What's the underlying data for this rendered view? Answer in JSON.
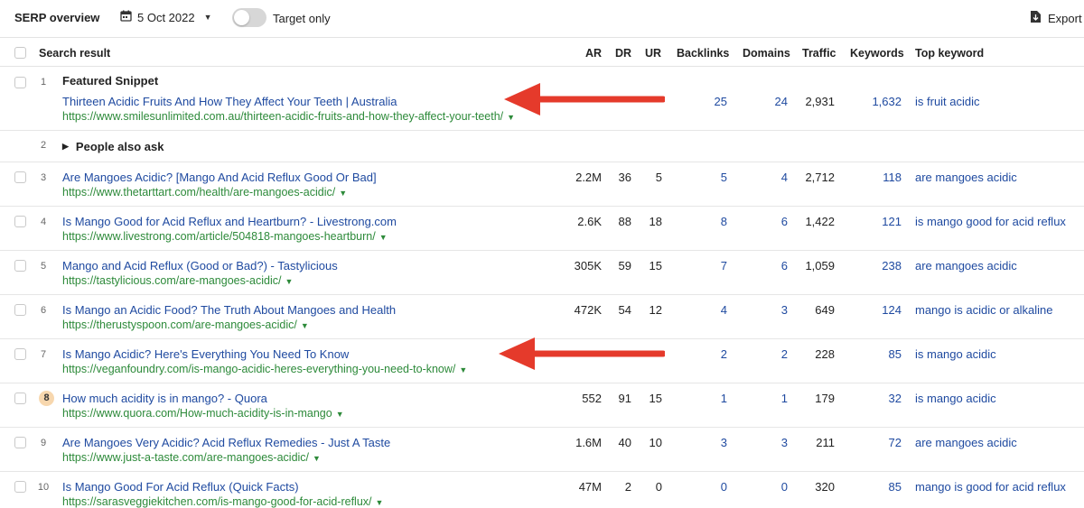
{
  "header": {
    "title": "SERP overview",
    "date": "5 Oct 2022",
    "toggle_label": "Target only",
    "export_label": "Export"
  },
  "columns": {
    "search_result": "Search result",
    "ar": "AR",
    "dr": "DR",
    "ur": "UR",
    "backlinks": "Backlinks",
    "domains": "Domains",
    "traffic": "Traffic",
    "keywords": "Keywords",
    "top_keyword": "Top keyword"
  },
  "featured": {
    "position": "1",
    "label": "Featured Snippet",
    "title": "Thirteen Acidic Fruits And How They Affect Your Teeth | Australia",
    "url": "https://www.smilesunlimited.com.au/thirteen-acidic-fruits-and-how-they-affect-your-teeth/",
    "ar": "",
    "dr": "",
    "ur": "",
    "backlinks": "25",
    "domains": "24",
    "traffic": "2,931",
    "keywords": "1,632",
    "top_keyword": "is fruit acidic"
  },
  "paa": {
    "position": "2",
    "label": "People also ask"
  },
  "rows": [
    {
      "position": "3",
      "title": "Are Mangoes Acidic? [Mango And Acid Reflux Good Or Bad]",
      "url": "https://www.thetarttart.com/health/are-mangoes-acidic/",
      "ar": "2.2M",
      "dr": "36",
      "ur": "5",
      "backlinks": "5",
      "domains": "4",
      "traffic": "2,712",
      "keywords": "118",
      "top_keyword": "are mangoes acidic"
    },
    {
      "position": "4",
      "title": "Is Mango Good for Acid Reflux and Heartburn? - Livestrong.com",
      "url": "https://www.livestrong.com/article/504818-mangoes-heartburn/",
      "ar": "2.6K",
      "dr": "88",
      "ur": "18",
      "backlinks": "8",
      "domains": "6",
      "traffic": "1,422",
      "keywords": "121",
      "top_keyword": "is mango good for acid reflux"
    },
    {
      "position": "5",
      "title": "Mango and Acid Reflux (Good or Bad?) - Tastylicious",
      "url": "https://tastylicious.com/are-mangoes-acidic/",
      "ar": "305K",
      "dr": "59",
      "ur": "15",
      "backlinks": "7",
      "domains": "6",
      "traffic": "1,059",
      "keywords": "238",
      "top_keyword": "are mangoes acidic"
    },
    {
      "position": "6",
      "title": "Is Mango an Acidic Food? The Truth About Mangoes and Health",
      "url": "https://therustyspoon.com/are-mangoes-acidic/",
      "ar": "472K",
      "dr": "54",
      "ur": "12",
      "backlinks": "4",
      "domains": "3",
      "traffic": "649",
      "keywords": "124",
      "top_keyword": "mango is acidic or alkaline"
    },
    {
      "position": "7",
      "title": "Is Mango Acidic? Here's Everything You Need To Know",
      "url": "https://veganfoundry.com/is-mango-acidic-heres-everything-you-need-to-know/",
      "ar": "",
      "dr": "",
      "ur": "",
      "backlinks": "2",
      "domains": "2",
      "traffic": "228",
      "keywords": "85",
      "top_keyword": "is mango acidic"
    },
    {
      "position": "8",
      "title": "How much acidity is in mango? - Quora",
      "url": "https://www.quora.com/How-much-acidity-is-in-mango",
      "ar": "552",
      "dr": "91",
      "ur": "15",
      "backlinks": "1",
      "domains": "1",
      "traffic": "179",
      "keywords": "32",
      "top_keyword": "is mango acidic"
    },
    {
      "position": "9",
      "title": "Are Mangoes Very Acidic? Acid Reflux Remedies - Just A Taste",
      "url": "https://www.just-a-taste.com/are-mangoes-acidic/",
      "ar": "1.6M",
      "dr": "40",
      "ur": "10",
      "backlinks": "3",
      "domains": "3",
      "traffic": "211",
      "keywords": "72",
      "top_keyword": "are mangoes acidic"
    },
    {
      "position": "10",
      "title": "Is Mango Good For Acid Reflux (Quick Facts)",
      "url": "https://sarasveggiekitchen.com/is-mango-good-for-acid-reflux/",
      "ar": "47M",
      "dr": "2",
      "ur": "0",
      "backlinks": "0",
      "domains": "0",
      "traffic": "320",
      "keywords": "85",
      "top_keyword": "mango is good for acid reflux"
    }
  ],
  "colors": {
    "link": "#1f4aa0",
    "url": "#2d8a3a",
    "arrow": "#e53a2b",
    "badge": "#f7d7ae"
  }
}
